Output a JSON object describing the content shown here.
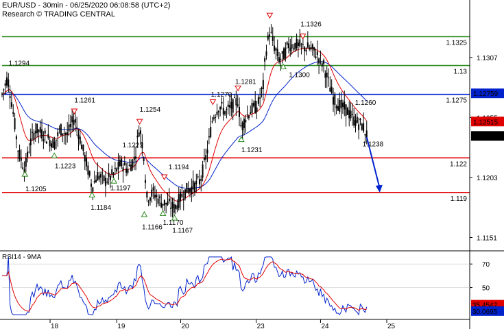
{
  "header": {
    "title": "EUR/USD - 30min - 06/25/2020 06:08:58 (UTC+2)",
    "source": "Research © TRADING CENTRAL"
  },
  "chart_data": [
    {
      "type": "candlestick",
      "ylim": [
        1.114,
        1.1355
      ],
      "y_ticks": [
        "1.1307",
        "1.1255",
        "1.1203",
        "1.1151"
      ],
      "x_ticks": [
        "18",
        "19",
        "20",
        "23",
        "24",
        "25"
      ],
      "grid": false,
      "levels": [
        {
          "value": 1.1325,
          "label": "1.1325",
          "color": "#2a8a1a"
        },
        {
          "value": 1.13,
          "label": "1.13",
          "color": "#2a8a1a"
        },
        {
          "value": 1.1275,
          "label": "1.1275",
          "color": "#0022cc"
        },
        {
          "value": 1.122,
          "label": "1.122",
          "color": "#e00000"
        },
        {
          "value": 1.119,
          "label": "1.119",
          "color": "#e00000"
        }
      ],
      "price_labels": [
        {
          "value": 1.12759,
          "text": "1.12759",
          "bg": "#0022cc"
        },
        {
          "value": 1.12515,
          "text": "1.12515",
          "bg": "#e00000"
        },
        {
          "value": 1.1239,
          "text": "1.1239",
          "bg": "#000000"
        }
      ],
      "annotations": [
        {
          "t": 0.012,
          "v": 1.1294,
          "text": "1.1294",
          "marker": "none",
          "tx": 0.014,
          "ty": 1.13
        },
        {
          "t": 0.049,
          "v": 1.121,
          "text": "1.1205",
          "marker": "up",
          "tx": 0.05,
          "ty": 1.1191
        },
        {
          "t": 0.112,
          "v": 1.1226,
          "text": "1.1223",
          "marker": "up",
          "tx": 0.113,
          "ty": 1.1211
        },
        {
          "t": 0.155,
          "v": 1.1257,
          "text": "1.1261",
          "marker": "down",
          "tx": 0.155,
          "ty": 1.1268
        },
        {
          "t": 0.193,
          "v": 1.1192,
          "text": "1.1184",
          "marker": "up",
          "tx": 0.19,
          "ty": 1.1175
        },
        {
          "t": 0.24,
          "v": 1.1204,
          "text": "1.1197",
          "marker": "up",
          "tx": 0.232,
          "ty": 1.1192
        },
        {
          "t": 0.295,
          "v": 1.1248,
          "text": "1.1254",
          "marker": "down",
          "tx": 0.295,
          "ty": 1.126
        },
        {
          "t": 0.295,
          "v": 1.1222,
          "text": "1.1222",
          "marker": "none",
          "tx": 0.258,
          "ty": 1.1229
        },
        {
          "t": 0.305,
          "v": 1.1175,
          "text": "1.1166",
          "marker": "up",
          "tx": 0.3,
          "ty": 1.1158
        },
        {
          "t": 0.345,
          "v": 1.1176,
          "text": "1.1170",
          "marker": "up",
          "tx": 0.345,
          "ty": 1.1162
        },
        {
          "t": 0.348,
          "v": 1.12,
          "text": "1.1194",
          "marker": "down",
          "tx": 0.357,
          "ty": 1.121
        },
        {
          "t": 0.37,
          "v": 1.1172,
          "text": "1.1167",
          "marker": "up",
          "tx": 0.365,
          "ty": 1.1155
        },
        {
          "t": 0.452,
          "v": 1.1265,
          "text": "1.1270",
          "marker": "down",
          "tx": 0.448,
          "ty": 1.1273
        },
        {
          "t": 0.506,
          "v": 1.1277,
          "text": "1.1281",
          "marker": "down",
          "tx": 0.5,
          "ty": 1.1284
        },
        {
          "t": 0.513,
          "v": 1.124,
          "text": "1.1231",
          "marker": "up",
          "tx": 0.513,
          "ty": 1.1225
        },
        {
          "t": 0.574,
          "v": 1.134,
          "text": "",
          "marker": "down"
        },
        {
          "t": 0.603,
          "v": 1.1303,
          "text": "1.1300",
          "marker": "up",
          "tx": 0.615,
          "ty": 1.129
        },
        {
          "t": 0.645,
          "v": 1.1322,
          "text": "1.1326",
          "marker": "down",
          "tx": 0.64,
          "ty": 1.1334
        },
        {
          "t": 0.757,
          "v": 1.1262,
          "text": "1.1260",
          "marker": "none",
          "tx": 0.757,
          "ty": 1.1266
        },
        {
          "t": 0.77,
          "v": 1.1235,
          "text": "1.1238",
          "marker": "none",
          "tx": 0.773,
          "ty": 1.123
        }
      ],
      "forecast": {
        "from": [
          0.782,
          1.1238
        ],
        "to": [
          0.81,
          1.119
        ]
      }
    },
    {
      "type": "line",
      "title": "RSI14 - 9MA",
      "ylim": [
        23,
        80
      ],
      "y_ticks": [
        "70",
        "50"
      ],
      "price_labels": [
        {
          "value": 35.4542,
          "text": "35.4542",
          "bg": "#e00000"
        },
        {
          "value": 30.0695,
          "text": "30.0695",
          "bg": "#0022cc"
        }
      ]
    }
  ],
  "colors": {
    "ma_fast": "#e00000",
    "ma_slow": "#0022cc",
    "candles": "#000000"
  }
}
